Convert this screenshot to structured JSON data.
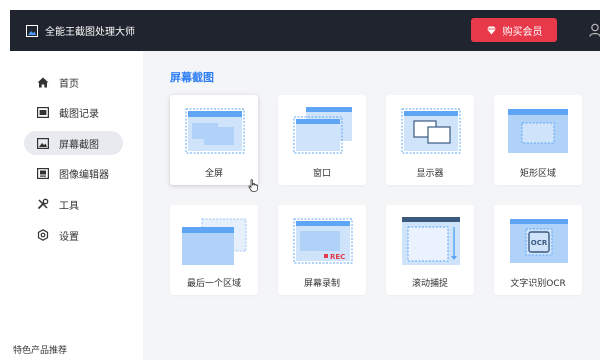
{
  "app": {
    "title": "全能王截图处理大师",
    "vip_label": "购买会员"
  },
  "colors": {
    "titlebar": "#20242f",
    "vip": "#e8394a",
    "accent": "#2f7ff4",
    "tile": "#5ea6f5"
  },
  "sidebar": {
    "items": [
      {
        "label": "首页",
        "icon": "home-icon"
      },
      {
        "label": "截图记录",
        "icon": "history-icon"
      },
      {
        "label": "屏幕截图",
        "icon": "screenshot-icon",
        "active": true
      },
      {
        "label": "图像编辑器",
        "icon": "image-editor-icon"
      },
      {
        "label": "工具",
        "icon": "tools-icon"
      },
      {
        "label": "设置",
        "icon": "gear-icon"
      }
    ],
    "footer": "特色产品推荐"
  },
  "main": {
    "section_title": "屏幕截图",
    "cards": [
      {
        "label": "全屏",
        "icon": "fullscreen-icon"
      },
      {
        "label": "窗口",
        "icon": "window-icon"
      },
      {
        "label": "显示器",
        "icon": "monitor-icon"
      },
      {
        "label": "矩形区域",
        "icon": "rect-region-icon"
      },
      {
        "label": "最后一个区域",
        "icon": "last-region-icon"
      },
      {
        "label": "屏幕录制",
        "icon": "screen-record-icon",
        "badge": "REC"
      },
      {
        "label": "滚动捕捉",
        "icon": "scroll-capture-icon"
      },
      {
        "label": "文字识别OCR",
        "icon": "ocr-icon",
        "badge": "OCR"
      }
    ]
  }
}
